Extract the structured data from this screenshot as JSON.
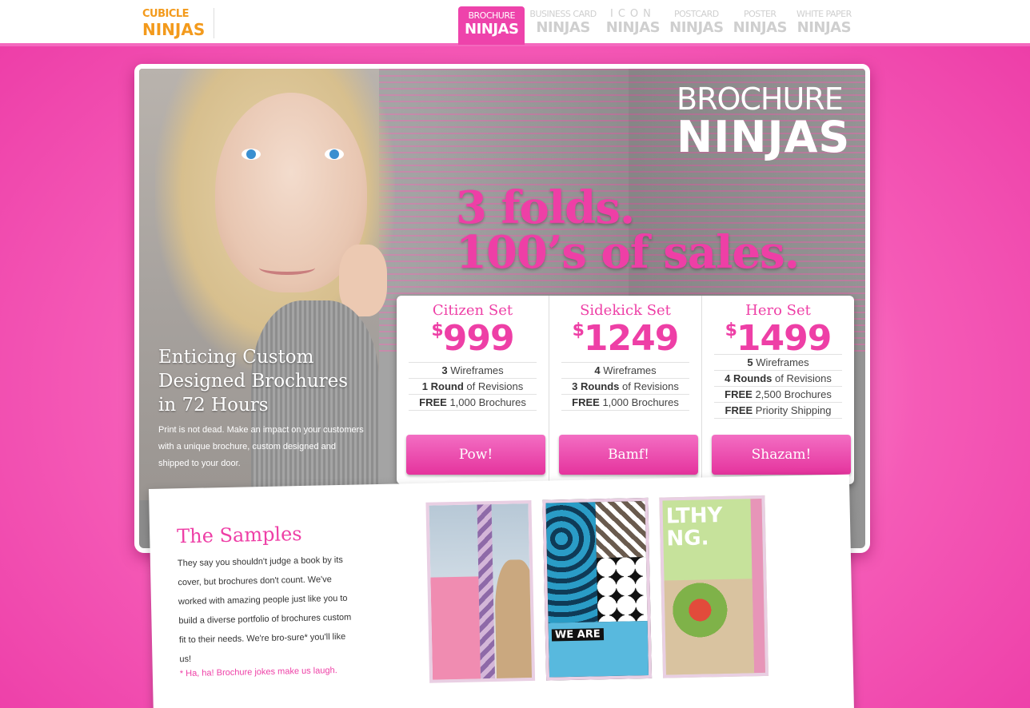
{
  "header": {
    "logo_line1": "CUBICLE",
    "logo_line2": "NINJAS",
    "nav": [
      {
        "small": "BROCHURE",
        "big": "NINJAS"
      },
      {
        "small": "BUSINESS CARD",
        "big": "NINJAS"
      },
      {
        "small": "ICON",
        "big": "NINJAS"
      },
      {
        "small": "POSTCARD",
        "big": "NINJAS"
      },
      {
        "small": "POSTER",
        "big": "NINJAS"
      },
      {
        "small": "WHITE PAPER",
        "big": "NINJAS"
      }
    ]
  },
  "hero": {
    "brand_line1": "BROCHURE",
    "brand_line2": "NINJAS",
    "tagline_line1": "3 folds.",
    "tagline_line2": "100’s of sales.",
    "heading": "Enticing Custom Designed Brochures in 72 Hours",
    "body": "Print is not dead. Make an impact on your customers with a unique brochure, custom designed and shipped to your door."
  },
  "plans": [
    {
      "name": "Citizen Set",
      "currency": "$",
      "price": "999",
      "features": [
        {
          "bold": "3",
          "rest": " Wireframes"
        },
        {
          "bold": "1 Round",
          "rest": " of Revisions"
        },
        {
          "bold": "FREE",
          "rest": " 1,000 Brochures"
        }
      ],
      "button": "Pow!"
    },
    {
      "name": "Sidekick Set",
      "currency": "$",
      "price": "1249",
      "features": [
        {
          "bold": "4",
          "rest": " Wireframes"
        },
        {
          "bold": "3 Rounds",
          "rest": " of Revisions"
        },
        {
          "bold": "FREE",
          "rest": " 1,000 Brochures"
        }
      ],
      "button": "Bamf!"
    },
    {
      "name": "Hero Set",
      "currency": "$",
      "price": "1499",
      "features": [
        {
          "bold": "5",
          "rest": " Wireframes"
        },
        {
          "bold": "4 Rounds",
          "rest": " of Revisions"
        },
        {
          "bold": "FREE",
          "rest": " 2,500 Brochures"
        },
        {
          "bold": "FREE",
          "rest": " Priority Shipping"
        }
      ],
      "button": "Shazam!"
    }
  ],
  "samples": {
    "title": "The Samples",
    "body": "They say you shouldn't judge a book by its cover, but brochures don't count. We've worked with amazing people just like you to build a diverse portfolio of brochures custom fit to their needs. We're bro-sure* you'll like us!",
    "note": "* Ha, ha! Brochure jokes make us laugh.",
    "thumb2_text": "WE ARE",
    "thumb3_text": "LTHY NG."
  },
  "colors": {
    "accent": "#ee3fa6",
    "logo": "#f39a1c",
    "panel_gray": "#8d8d8d"
  }
}
